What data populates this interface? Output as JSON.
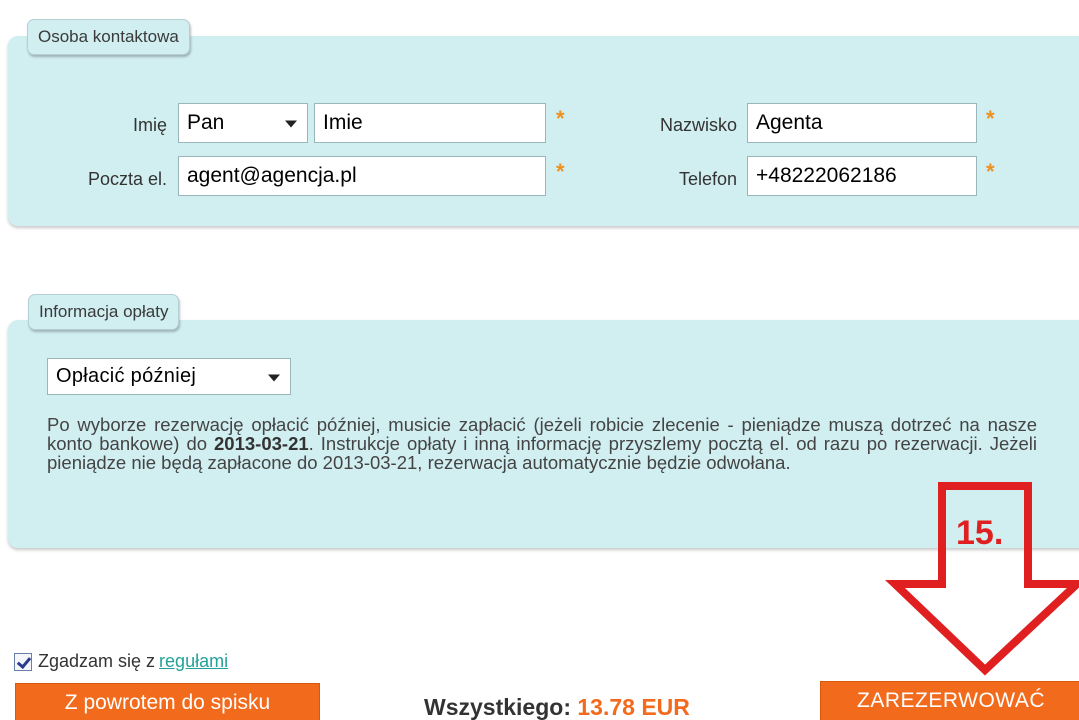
{
  "contact": {
    "legend": "Osoba kontaktowa",
    "first_name_label": "Imię",
    "title_select": "Pan",
    "first_name_value": "Imie",
    "last_name_label": "Nazwisko",
    "last_name_value": "Agenta",
    "email_label": "Poczta el.",
    "email_value": "agent@agencja.pl",
    "phone_label": "Telefon",
    "phone_value": "+48222062186",
    "required_mark": "*"
  },
  "payment": {
    "legend": "Informacja opłaty",
    "method_select": "Opłacić później",
    "info_part1": "Po wyborze rezerwację opłacić później, musicie zapłacić (jeżeli robicie zlecenie - pieniądze muszą dotrzeć na nasze konto bankowe) do ",
    "info_date": "2013-03-21",
    "info_part2": ". Instrukcje opłaty i inną informację przyszlemy pocztą el. od razu po rezerwacji. Jeżeli pieniądze nie będą zapłacone do 2013-03-21, rezerwacja automatycznie będzie odwołana."
  },
  "agreement": {
    "checked": true,
    "text": "Zgadzam się z",
    "link": "regułami"
  },
  "footer": {
    "back_button": "Z powrotem do spisku",
    "total_label": "Wszystkiego:",
    "total_amount": "13.78 EUR",
    "reserve_button": "ZAREZERWOWAĆ"
  },
  "annotation": {
    "step_number": "15.",
    "arrow_color": "#e02020"
  },
  "colors": {
    "panel_bg": "#d1eef1",
    "accent_orange": "#f26a1b",
    "required_star": "#f0901e",
    "link_teal": "#24a19a"
  }
}
